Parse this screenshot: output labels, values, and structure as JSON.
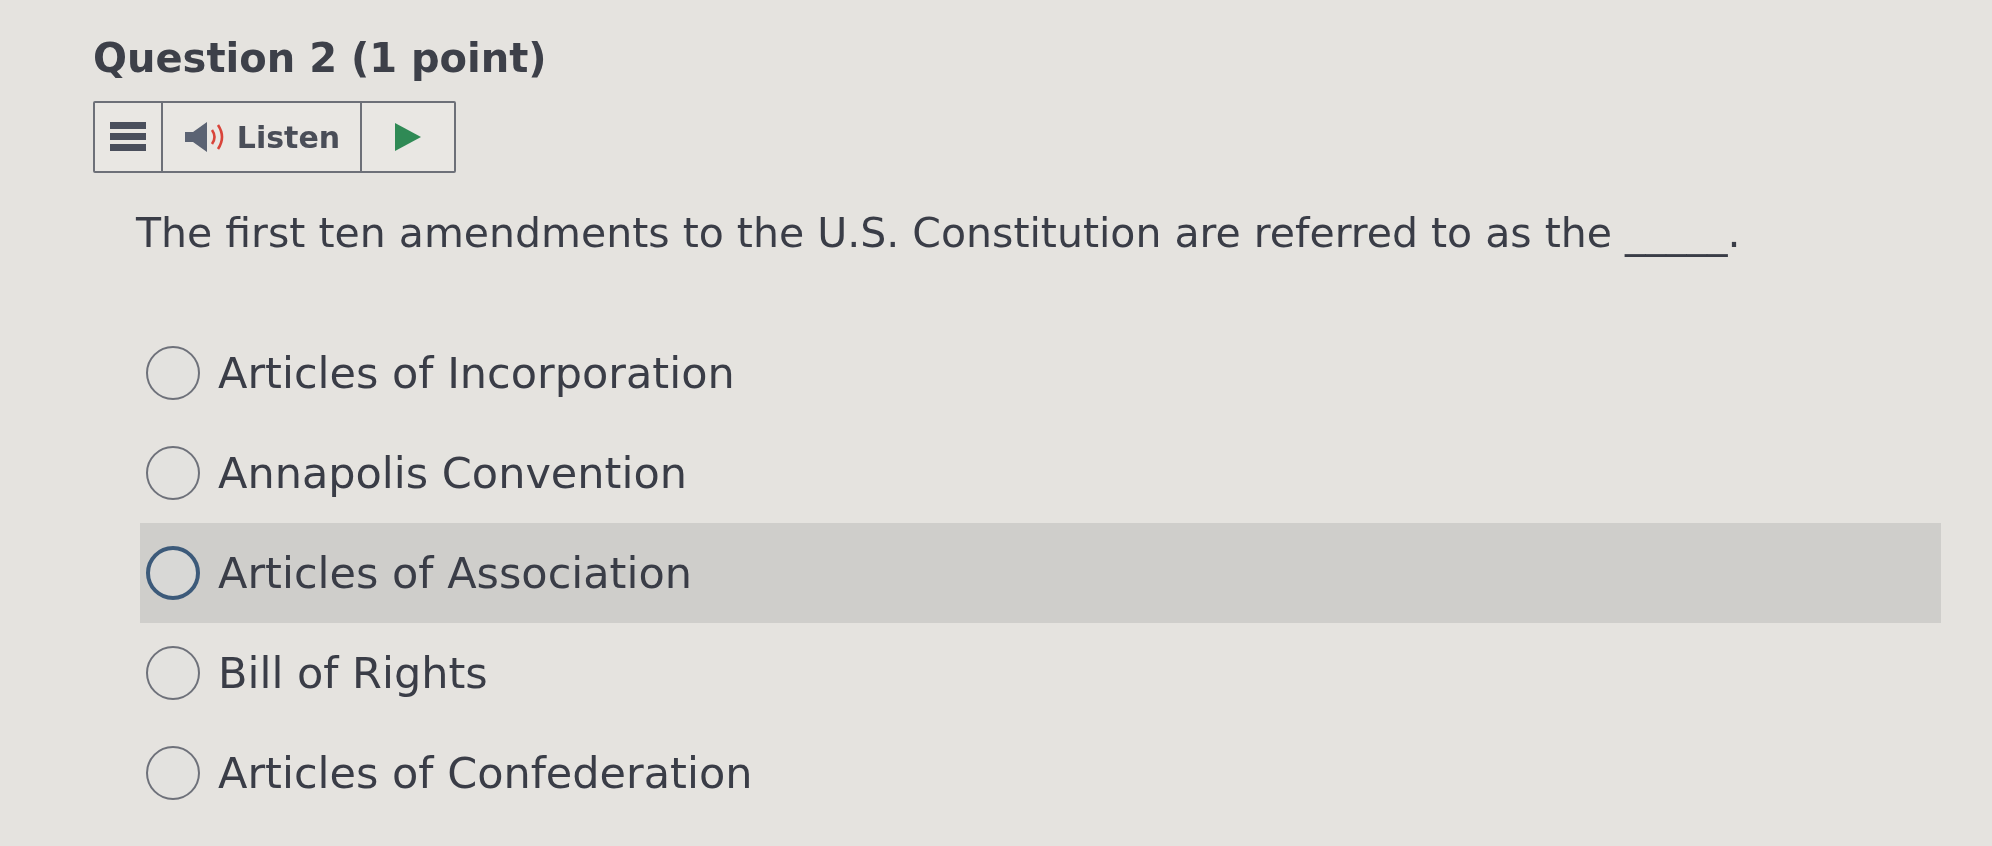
{
  "question": {
    "title": "Question 2 (1 point)",
    "text": "The first ten amendments to the U.S. Constitution are referred to as the _____."
  },
  "listen_toolbar": {
    "label": "Listen"
  },
  "options": [
    {
      "label": "Articles of Incorporation",
      "selected": false,
      "hovered": false
    },
    {
      "label": "Annapolis Convention",
      "selected": false,
      "hovered": false
    },
    {
      "label": "Articles of Association",
      "selected": false,
      "hovered": true
    },
    {
      "label": "Bill of Rights",
      "selected": false,
      "hovered": false
    },
    {
      "label": "Articles of Confederation",
      "selected": false,
      "hovered": false
    }
  ]
}
